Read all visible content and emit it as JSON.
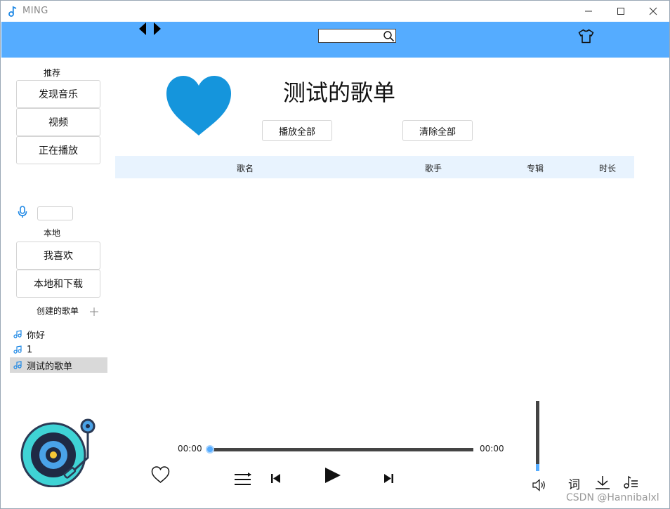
{
  "window": {
    "title": "MING"
  },
  "header": {
    "search": {
      "value": "",
      "placeholder": ""
    }
  },
  "sidebar": {
    "recommend_label": "推荐",
    "recommend_items": [
      {
        "label": "发现音乐"
      },
      {
        "label": "视频"
      },
      {
        "label": "正在播放"
      }
    ],
    "local_label": "本地",
    "local_items": [
      {
        "label": "我喜欢"
      },
      {
        "label": "本地和下载"
      }
    ],
    "created_label": "创建的歌单",
    "playlists": [
      {
        "name": "你好",
        "selected": false
      },
      {
        "name": "1",
        "selected": false
      },
      {
        "name": "测试的歌单",
        "selected": true
      }
    ]
  },
  "main": {
    "playlist_title": "测试的歌单",
    "play_all_label": "播放全部",
    "clear_all_label": "清除全部",
    "columns": [
      "歌名",
      "歌手",
      "专辑",
      "时长"
    ],
    "rows": []
  },
  "player": {
    "current_time": "00:00",
    "total_time": "00:00",
    "progress": 0,
    "volume": 0.1,
    "lyrics_label": "词"
  },
  "watermark": "CSDN @Hannibalxl",
  "colors": {
    "accent": "#55acff",
    "heart": "#1595dc",
    "table_header_bg": "#e8f3fe",
    "selected_bg": "#d9d9d9"
  }
}
